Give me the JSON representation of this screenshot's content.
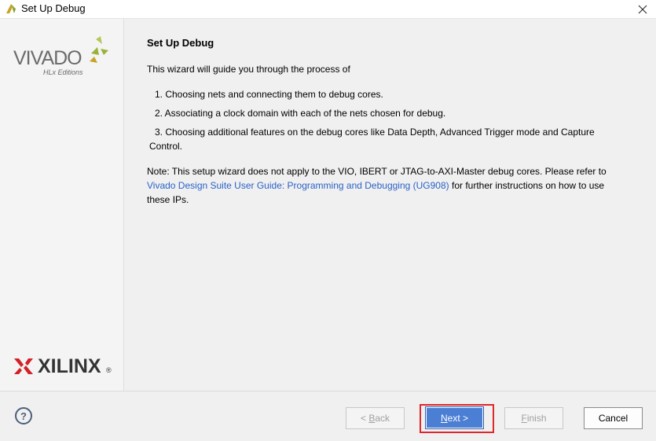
{
  "window": {
    "title": "Set Up Debug",
    "close_glyph": "✕"
  },
  "sidebar": {
    "vivado_word": "VIVADO",
    "vivado_sub": "HLx Editions",
    "xilinx_word": "XILINX",
    "xilinx_reg": "®",
    "brand_colors": {
      "leaf": "#9ab23a",
      "xilinx_red": "#d42027"
    }
  },
  "main": {
    "heading": "Set Up Debug",
    "intro": "This wizard will guide you through the process of",
    "steps": [
      "1.  Choosing nets and connecting them to debug cores.",
      "2.  Associating a clock domain with each of the nets chosen for debug.",
      "3.  Choosing additional features on the debug cores like Data Depth, Advanced Trigger mode and Capture",
      "Control."
    ],
    "note_part1": "Note: This setup wizard does not apply to the VIO, IBERT or JTAG-to-AXI-Master debug cores. Please refer to",
    "note_link": "Vivado Design Suite User Guide: Programming and Debugging (UG908)",
    "note_part2": " for further instructions on how to use",
    "note_part3": "these IPs."
  },
  "footer": {
    "help_label": "?",
    "back_mnemonic_prefix": "< ",
    "back_mnemonic": "B",
    "back_rest": "ack",
    "next_mnemonic": "N",
    "next_rest": "ext >",
    "finish_mnemonic": "F",
    "finish_rest": "inish",
    "cancel_label": "Cancel"
  }
}
